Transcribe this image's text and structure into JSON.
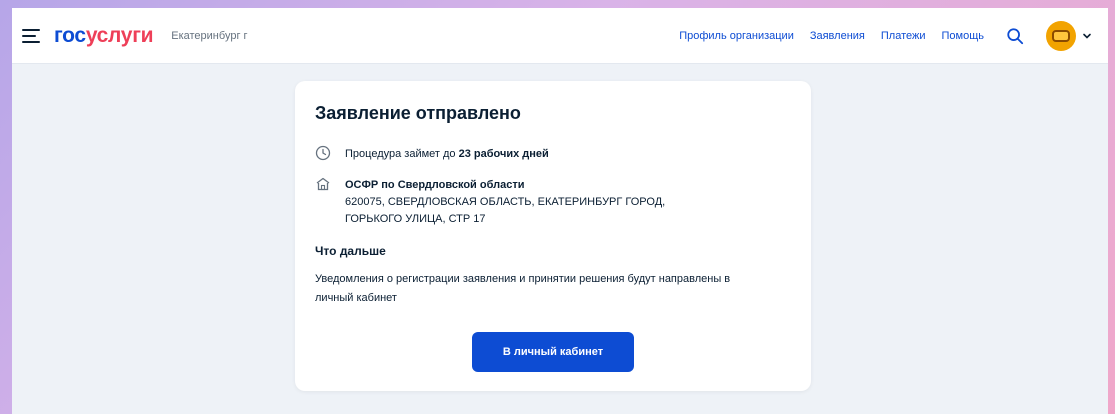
{
  "header": {
    "logo_part1": "гос",
    "logo_part2": "услуги",
    "city": "Екатеринбург г",
    "nav": [
      {
        "label": "Профиль организации"
      },
      {
        "label": "Заявления"
      },
      {
        "label": "Платежи"
      },
      {
        "label": "Помощь"
      }
    ],
    "icons": {
      "menu": "menu-icon",
      "search": "search-icon",
      "avatar": "avatar-icon",
      "chevron": "chevron-down-icon"
    }
  },
  "card": {
    "title": "Заявление отправлено",
    "duration_prefix": "Процедура займет до",
    "duration_value": "23 рабочих дней",
    "office_name": "ОСФР по Свердловской области",
    "address_line1": "620075, СВЕРДЛОВСКАЯ ОБЛАСТЬ, ЕКАТЕРИНБУРГ ГОРОД,",
    "address_line2": "ГОРЬКОГО УЛИЦА, СТР 17",
    "next_title": "Что дальше",
    "next_text": "Уведомления о регистрации заявления и принятии решения будут направлены в личный кабинет",
    "button_label": "В личный кабинет"
  },
  "colors": {
    "brand_blue": "#0d4cd3",
    "brand_red": "#ee3f58",
    "background": "#eef2f7",
    "avatar": "#f2a300"
  }
}
